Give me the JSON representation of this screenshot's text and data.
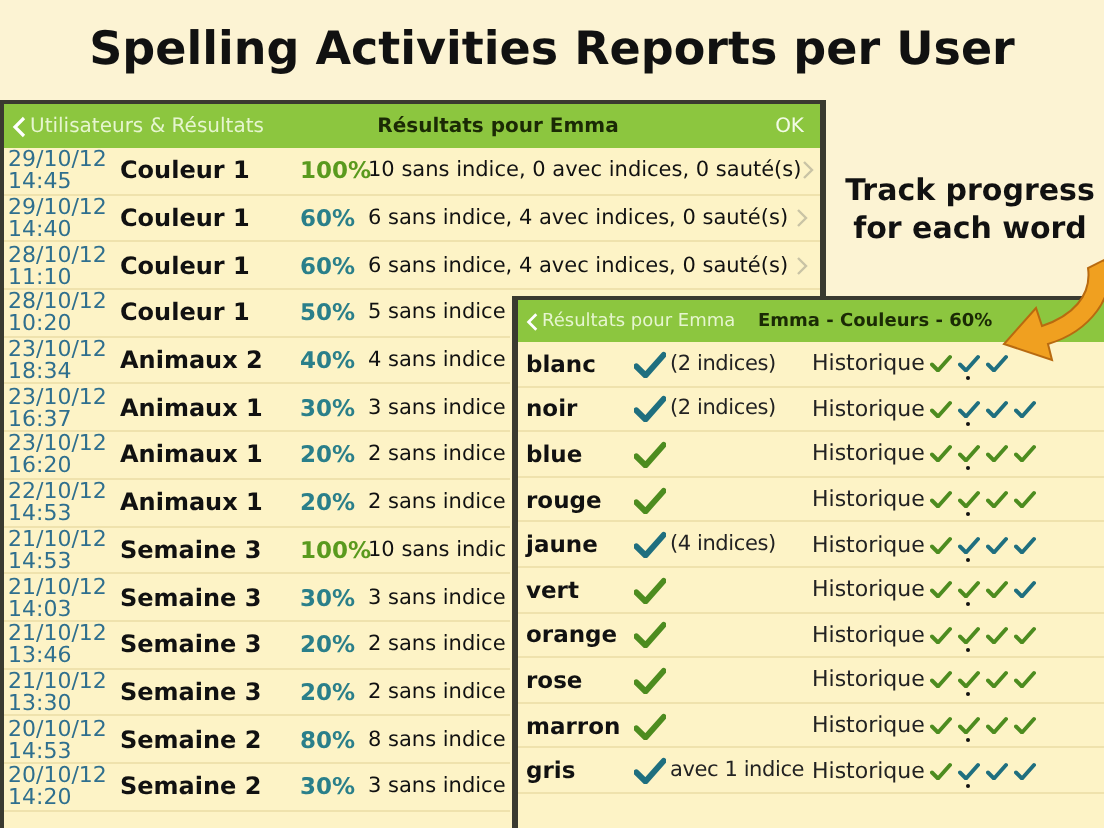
{
  "headline": "Spelling Activities Reports per User",
  "results": {
    "back": "Utilisateurs & Résultats",
    "title": "Résultats pour Emma",
    "done": "OK",
    "rows": [
      {
        "date": "29/10/12",
        "time": "14:45",
        "activity": "Couleur 1",
        "percent": "100%",
        "color": "#5a9a1e",
        "summary": "10 sans indice, 0 avec indices, 0 sauté(s)",
        "chevron": true
      },
      {
        "date": "29/10/12",
        "time": "14:40",
        "activity": "Couleur 1",
        "percent": "60%",
        "color": "#2a7f8a",
        "summary": "6 sans indice, 4 avec indices, 0 sauté(s)",
        "chevron": true
      },
      {
        "date": "28/10/12",
        "time": "11:10",
        "activity": "Couleur 1",
        "percent": "60%",
        "color": "#2a7f8a",
        "summary": "6 sans indice, 4 avec indices, 0 sauté(s)",
        "chevron": true
      },
      {
        "date": "28/10/12",
        "time": "10:20",
        "activity": "Couleur 1",
        "percent": "50%",
        "color": "#2a7f8a",
        "summary": "5 sans indice",
        "chevron": false
      },
      {
        "date": "23/10/12",
        "time": "18:34",
        "activity": "Animaux 2",
        "percent": "40%",
        "color": "#2a7f8a",
        "summary": "4 sans indice",
        "chevron": false
      },
      {
        "date": "23/10/12",
        "time": "16:37",
        "activity": "Animaux 1",
        "percent": "30%",
        "color": "#2a7f8a",
        "summary": "3 sans indice",
        "chevron": false
      },
      {
        "date": "23/10/12",
        "time": "16:20",
        "activity": "Animaux 1",
        "percent": "20%",
        "color": "#2a7f8a",
        "summary": "2 sans indice",
        "chevron": false
      },
      {
        "date": "22/10/12",
        "time": "14:53",
        "activity": "Animaux 1",
        "percent": "20%",
        "color": "#2a7f8a",
        "summary": "2 sans indice",
        "chevron": false
      },
      {
        "date": "21/10/12",
        "time": "14:53",
        "activity": "Semaine 3",
        "percent": "100%",
        "color": "#5a9a1e",
        "summary": "10 sans indic",
        "chevron": false
      },
      {
        "date": "21/10/12",
        "time": "14:03",
        "activity": "Semaine 3",
        "percent": "30%",
        "color": "#2a7f8a",
        "summary": "3 sans indice",
        "chevron": false
      },
      {
        "date": "21/10/12",
        "time": "13:46",
        "activity": "Semaine 3",
        "percent": "20%",
        "color": "#2a7f8a",
        "summary": "2 sans indice",
        "chevron": false
      },
      {
        "date": "21/10/12",
        "time": "13:30",
        "activity": "Semaine 3",
        "percent": "20%",
        "color": "#2a7f8a",
        "summary": "2 sans indice",
        "chevron": false
      },
      {
        "date": "20/10/12",
        "time": "14:53",
        "activity": "Semaine 2",
        "percent": "80%",
        "color": "#2a7f8a",
        "summary": "8 sans indice",
        "chevron": false
      },
      {
        "date": "20/10/12",
        "time": "14:20",
        "activity": "Semaine 2",
        "percent": "30%",
        "color": "#2a7f8a",
        "summary": "3 sans indice",
        "chevron": false
      }
    ]
  },
  "callout": {
    "line1": "Track progress",
    "line2": "for each word"
  },
  "words": {
    "back": "Résultats pour Emma",
    "title": "Emma - Couleurs - 60%",
    "rows": [
      {
        "word": "blanc",
        "color": "#1f6f7f",
        "hints": "(2 indices)",
        "history_label": "Historique",
        "history": [
          {
            "color": "#4d8c1f",
            "dotted": false
          },
          {
            "color": "#1f6f7f",
            "dotted": true
          },
          {
            "color": "#1f6f7f",
            "dotted": false
          }
        ]
      },
      {
        "word": "noir",
        "color": "#1f6f7f",
        "hints": "(2 indices)",
        "history_label": "Historique",
        "history": [
          {
            "color": "#4d8c1f",
            "dotted": false
          },
          {
            "color": "#1f6f7f",
            "dotted": true
          },
          {
            "color": "#1f6f7f",
            "dotted": false
          },
          {
            "color": "#1f6f7f",
            "dotted": false
          }
        ]
      },
      {
        "word": "blue",
        "color": "#4d8c1f",
        "history_label": "Historique",
        "history": [
          {
            "color": "#4d8c1f",
            "dotted": false
          },
          {
            "color": "#4d8c1f",
            "dotted": true
          },
          {
            "color": "#4d8c1f",
            "dotted": false
          },
          {
            "color": "#4d8c1f",
            "dotted": false
          }
        ]
      },
      {
        "word": "rouge",
        "color": "#4d8c1f",
        "history_label": "Historique",
        "history": [
          {
            "color": "#4d8c1f",
            "dotted": false
          },
          {
            "color": "#4d8c1f",
            "dotted": true
          },
          {
            "color": "#4d8c1f",
            "dotted": false
          },
          {
            "color": "#4d8c1f",
            "dotted": false
          }
        ]
      },
      {
        "word": "jaune",
        "color": "#1f6f7f",
        "hints": "(4 indices)",
        "history_label": "Historique",
        "history": [
          {
            "color": "#4d8c1f",
            "dotted": false
          },
          {
            "color": "#1f6f7f",
            "dotted": true
          },
          {
            "color": "#1f6f7f",
            "dotted": false
          },
          {
            "color": "#1f6f7f",
            "dotted": false
          }
        ]
      },
      {
        "word": "vert",
        "color": "#4d8c1f",
        "history_label": "Historique",
        "history": [
          {
            "color": "#4d8c1f",
            "dotted": false
          },
          {
            "color": "#4d8c1f",
            "dotted": true
          },
          {
            "color": "#4d8c1f",
            "dotted": false
          },
          {
            "color": "#1f6f7f",
            "dotted": false
          }
        ]
      },
      {
        "word": "orange",
        "color": "#4d8c1f",
        "history_label": "Historique",
        "history": [
          {
            "color": "#4d8c1f",
            "dotted": false
          },
          {
            "color": "#4d8c1f",
            "dotted": true
          },
          {
            "color": "#4d8c1f",
            "dotted": false
          },
          {
            "color": "#4d8c1f",
            "dotted": false
          }
        ]
      },
      {
        "word": "rose",
        "color": "#4d8c1f",
        "history_label": "Historique",
        "history": [
          {
            "color": "#4d8c1f",
            "dotted": false
          },
          {
            "color": "#4d8c1f",
            "dotted": true
          },
          {
            "color": "#4d8c1f",
            "dotted": false
          },
          {
            "color": "#4d8c1f",
            "dotted": false
          }
        ]
      },
      {
        "word": "marron",
        "color": "#4d8c1f",
        "history_label": "Historique",
        "history": [
          {
            "color": "#4d8c1f",
            "dotted": false
          },
          {
            "color": "#4d8c1f",
            "dotted": true
          },
          {
            "color": "#4d8c1f",
            "dotted": false
          },
          {
            "color": "#4d8c1f",
            "dotted": false
          }
        ]
      },
      {
        "word": "gris",
        "color": "#1f6f7f",
        "hints": "avec 1 indice",
        "history_label": "Historique",
        "history": [
          {
            "color": "#4d8c1f",
            "dotted": false
          },
          {
            "color": "#1f6f7f",
            "dotted": true
          },
          {
            "color": "#1f6f7f",
            "dotted": false
          },
          {
            "color": "#1f6f7f",
            "dotted": false
          }
        ]
      }
    ]
  }
}
